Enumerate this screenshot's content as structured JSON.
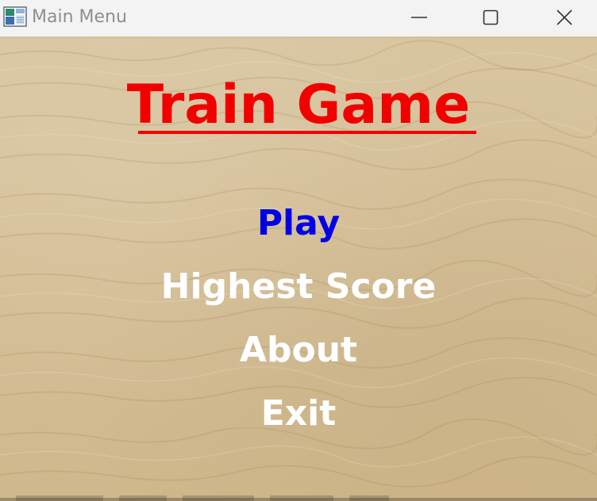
{
  "window": {
    "title": "Main Menu",
    "controls": {
      "minimize_icon": "minimize-icon",
      "maximize_icon": "maximize-icon",
      "close_icon": "close-icon"
    }
  },
  "game": {
    "title": "Train Game",
    "title_color": "#f20000"
  },
  "menu": {
    "play": "Play",
    "highest_score": "Highest Score",
    "about": "About",
    "exit": "Exit",
    "selected_color": "#0000e6",
    "default_color": "#ffffff"
  }
}
